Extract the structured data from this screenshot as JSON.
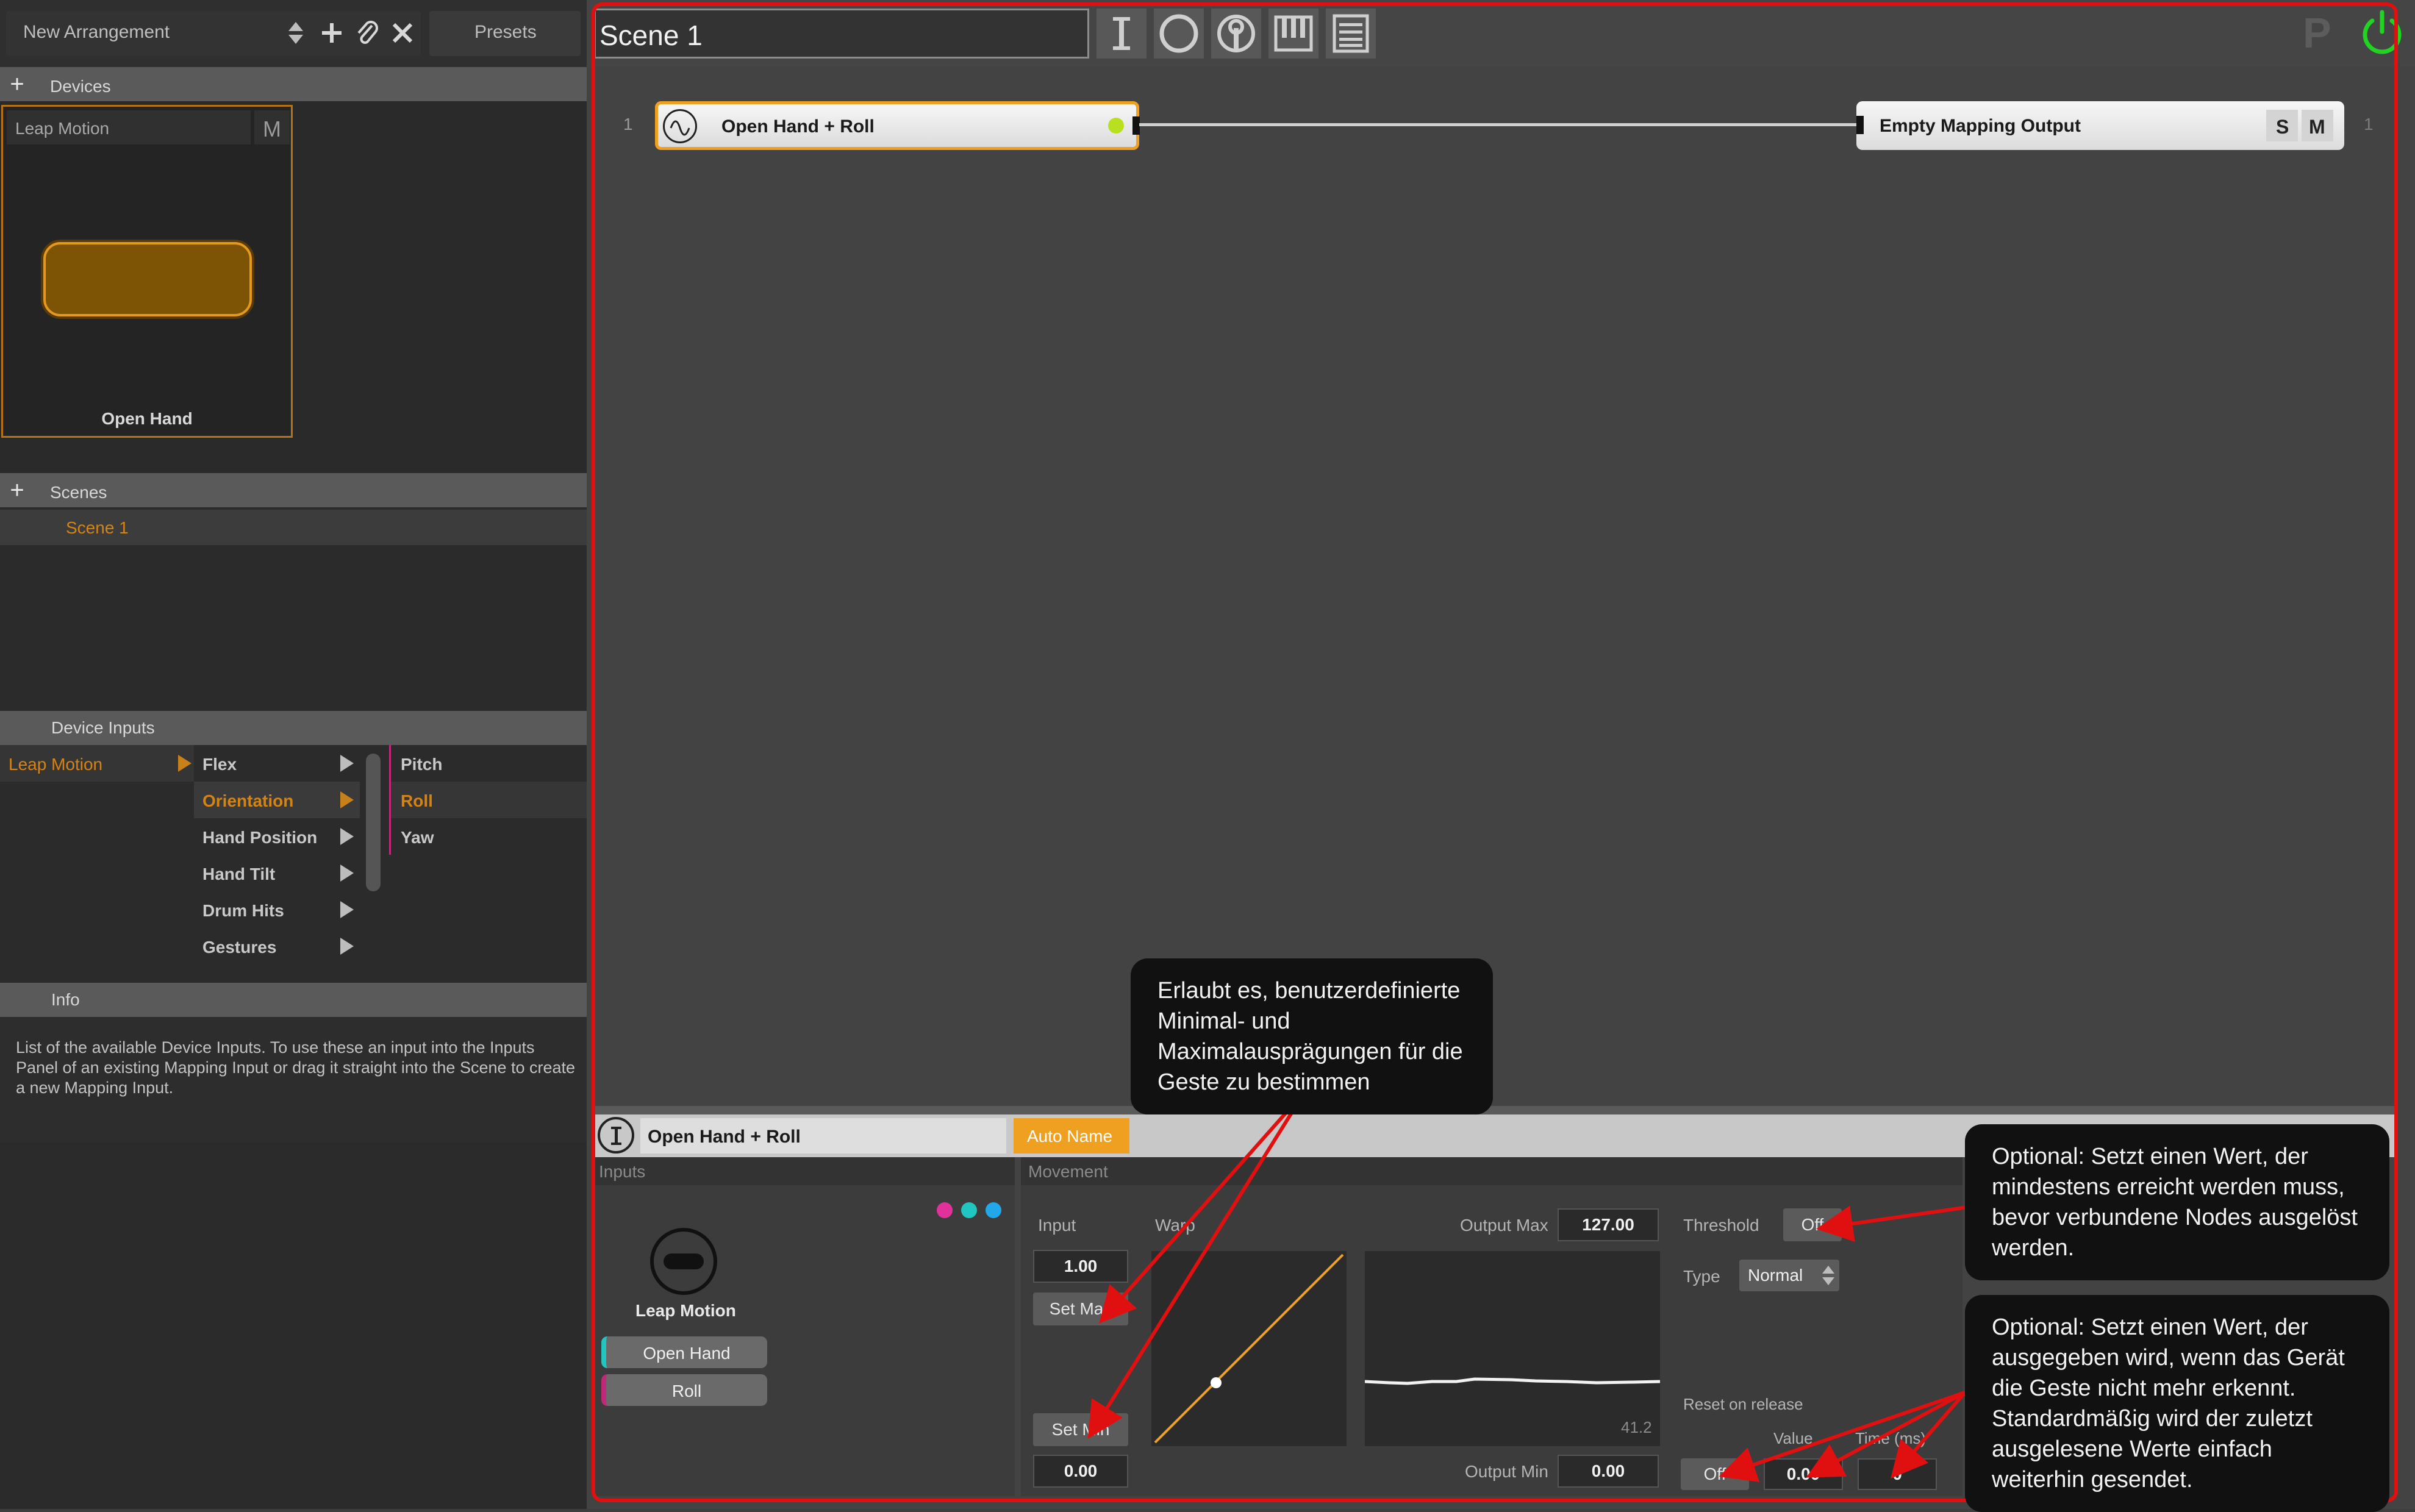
{
  "arrangement": {
    "name": "New Arrangement",
    "presets_label": "Presets"
  },
  "devices": {
    "title": "Devices",
    "device_name": "Leap Motion",
    "mute_label": "M",
    "gesture_label": "Open Hand"
  },
  "scenes": {
    "title": "Scenes",
    "items": [
      "Scene 1"
    ]
  },
  "device_inputs": {
    "title": "Device Inputs",
    "devices": [
      "Leap Motion"
    ],
    "categories": [
      "Flex",
      "Orientation",
      "Hand Position",
      "Hand Tilt",
      "Drum Hits",
      "Gestures"
    ],
    "params": [
      "Pitch",
      "Roll",
      "Yaw"
    ]
  },
  "info": {
    "title": "Info",
    "text": "List of the available Device Inputs. To use these an input into the Inputs Panel of an existing Mapping Input or drag it straight into the Scene to create a new Mapping Input."
  },
  "scene": {
    "name": "Scene 1",
    "p_label": "P",
    "row_left_number": "1",
    "row_right_number": "1",
    "input_node_label": "Open Hand + Roll",
    "output_node_label": "Empty Mapping Output",
    "solo_label": "S",
    "mute_label": "M"
  },
  "detail": {
    "name": "Open Hand + Roll",
    "auto_name_label": "Auto Name",
    "inputs_title": "Inputs",
    "movement_title": "Movement",
    "device_label": "Leap Motion",
    "tag_open_hand": "Open Hand",
    "tag_roll": "Roll",
    "input_label": "Input",
    "input_max_value": "1.00",
    "set_max_label": "Set Max",
    "set_min_label": "Set Min",
    "input_min_value": "0.00",
    "warp_label": "Warp",
    "output_max_label": "Output Max",
    "output_max_value": "127.00",
    "output_min_label": "Output Min",
    "output_min_value": "0.00",
    "monitor_value": "41.2",
    "threshold_label": "Threshold",
    "threshold_value": "Off",
    "type_label": "Type",
    "type_value": "Normal",
    "reset_label": "Reset on release",
    "reset_value": "Off",
    "value_label": "Value",
    "value_value": "0.00",
    "time_label": "Time (ms)",
    "time_value": "0"
  },
  "callouts": {
    "minmax": "Erlaubt es, benutzerdefinierte Minimal- und Maximalausprägungen für die Geste zu bestimmen",
    "threshold": "Optional: Setzt einen Wert, der mindestens erreicht werden muss, bevor verbundene Nodes ausgelöst werden.",
    "reset": "Optional: Setzt einen Wert, der ausgegeben wird, wenn das Gerät die Geste nicht mehr erkennt. Standardmäßig wird der zuletzt ausgelesene Werte einfach weiterhin gesendet."
  },
  "colors": {
    "accent": "#f0a020",
    "highlight_red": "#e01010",
    "power_green": "#22d422",
    "dot_magenta": "#e0329a",
    "dot_teal": "#22c6c0",
    "dot_blue": "#22a8e8",
    "node_active_dot": "#b8e020"
  },
  "icons": [
    "add-icon",
    "attach-icon",
    "close-icon",
    "sort-icon",
    "input-icon",
    "circle-icon",
    "pedal-icon",
    "piano-icon",
    "list-icon",
    "power-icon",
    "sine-wave-icon"
  ]
}
